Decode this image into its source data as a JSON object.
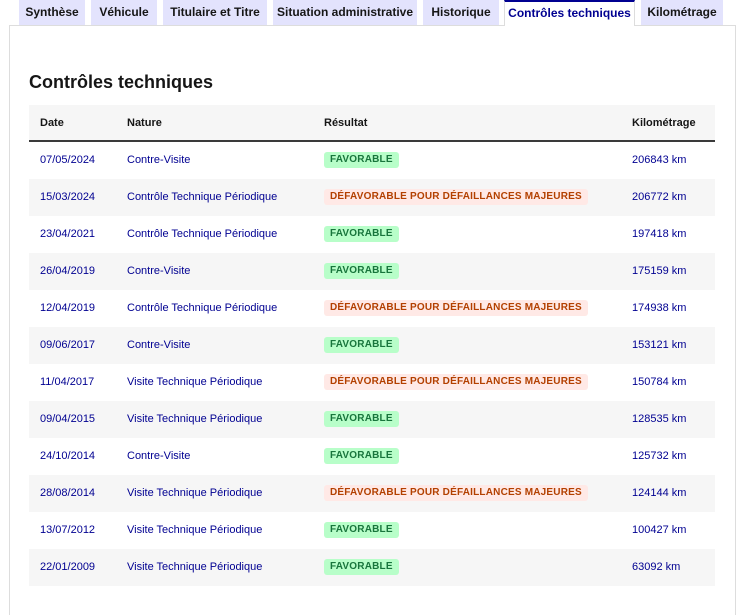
{
  "tabs": [
    {
      "label": "Synthèse",
      "active": false
    },
    {
      "label": "Véhicule",
      "active": false
    },
    {
      "label": "Titulaire et Titre",
      "active": false
    },
    {
      "label": "Situation administrative",
      "active": false
    },
    {
      "label": "Historique",
      "active": false
    },
    {
      "label": "Contrôles techniques",
      "active": true
    },
    {
      "label": "Kilométrage",
      "active": false
    }
  ],
  "section": {
    "title": "Contrôles techniques"
  },
  "table": {
    "headers": {
      "date": "Date",
      "nature": "Nature",
      "result": "Résultat",
      "km": "Kilométrage"
    },
    "rows": [
      {
        "date": "07/05/2024",
        "nature": "Contre-Visite",
        "result": "FAVORABLE",
        "status": "fav",
        "km": "206843 km"
      },
      {
        "date": "15/03/2024",
        "nature": "Contrôle Technique Périodique",
        "result": "DÉFAVORABLE POUR DÉFAILLANCES MAJEURES",
        "status": "defav",
        "km": "206772 km"
      },
      {
        "date": "23/04/2021",
        "nature": "Contrôle Technique Périodique",
        "result": "FAVORABLE",
        "status": "fav",
        "km": "197418 km"
      },
      {
        "date": "26/04/2019",
        "nature": "Contre-Visite",
        "result": "FAVORABLE",
        "status": "fav",
        "km": "175159 km"
      },
      {
        "date": "12/04/2019",
        "nature": "Contrôle Technique Périodique",
        "result": "DÉFAVORABLE POUR DÉFAILLANCES MAJEURES",
        "status": "defav",
        "km": "174938 km"
      },
      {
        "date": "09/06/2017",
        "nature": "Contre-Visite",
        "result": "FAVORABLE",
        "status": "fav",
        "km": "153121 km"
      },
      {
        "date": "11/04/2017",
        "nature": "Visite Technique Périodique",
        "result": "DÉFAVORABLE POUR DÉFAILLANCES MAJEURES",
        "status": "defav",
        "km": "150784 km"
      },
      {
        "date": "09/04/2015",
        "nature": "Visite Technique Périodique",
        "result": "FAVORABLE",
        "status": "fav",
        "km": "128535 km"
      },
      {
        "date": "24/10/2014",
        "nature": "Contre-Visite",
        "result": "FAVORABLE",
        "status": "fav",
        "km": "125732 km"
      },
      {
        "date": "28/08/2014",
        "nature": "Visite Technique Périodique",
        "result": "DÉFAVORABLE POUR DÉFAILLANCES MAJEURES",
        "status": "defav",
        "km": "124144 km"
      },
      {
        "date": "13/07/2012",
        "nature": "Visite Technique Périodique",
        "result": "FAVORABLE",
        "status": "fav",
        "km": "100427 km"
      },
      {
        "date": "22/01/2009",
        "nature": "Visite Technique Périodique",
        "result": "FAVORABLE",
        "status": "fav",
        "km": "63092 km"
      }
    ]
  },
  "colors": {
    "link": "#000091",
    "tab_bg": "#e3e3fd",
    "favorable_bg": "#b8fec9",
    "favorable_text": "#18753c",
    "defavorable_bg": "#ffe9e6",
    "defavorable_text": "#b34000"
  }
}
